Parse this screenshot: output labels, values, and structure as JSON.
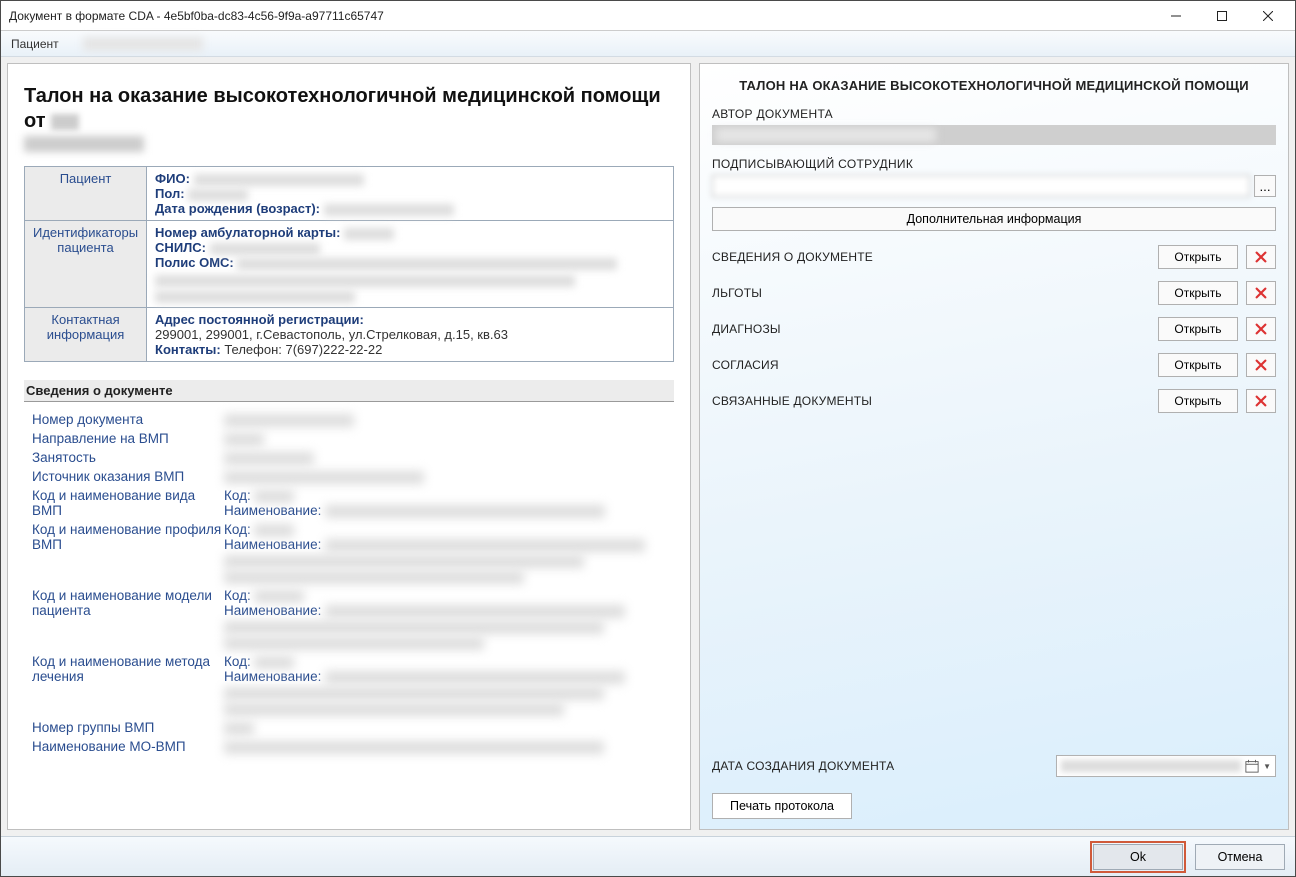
{
  "window": {
    "title": "Документ в формате CDA - 4e5bf0ba-dc83-4c56-9f9a-a97711c65747"
  },
  "header": {
    "patient_label": "Пациент"
  },
  "left": {
    "title_prefix": "Талон на оказание высокотехнологичной медицинской помощи от",
    "patient_block": {
      "label": "Пациент",
      "fio": "ФИО:",
      "sex": "Пол:",
      "dob": "Дата рождения (возраст):"
    },
    "ids_block": {
      "label": "Идентификаторы пациента",
      "card": "Номер амбулаторной карты:",
      "snils": "СНИЛС:",
      "oms": "Полис ОМС:"
    },
    "contact_block": {
      "label": "Контактная информация",
      "addr_label": "Адрес постоянной регистрации:",
      "addr_value": "299001, 299001, г.Севастополь, ул.Стрелковая, д.15, кв.63",
      "contacts_label": "Контакты:",
      "contacts_value": "Телефон: 7(697)222-22-22"
    },
    "section_title": "Сведения о документе",
    "rows": {
      "doc_number": "Номер документа",
      "referral": "Направление на ВМП",
      "employment": "Занятость",
      "source": "Источник оказания ВМП",
      "kind": "Код и наименование вида ВМП",
      "profile": "Код и наименование профиля ВМП",
      "model": "Код и наименование модели пациента",
      "method": "Код и наименование метода лечения",
      "group": "Номер группы ВМП",
      "mo": "Наименование МО-ВМП",
      "code_lbl": "Код:",
      "name_lbl": "Наименование:"
    }
  },
  "right": {
    "title": "ТАЛОН НА ОКАЗАНИЕ ВЫСОКОТЕХНОЛОГИЧНОЙ МЕДИЦИНСКОЙ ПОМОЩИ",
    "author_label": "АВТОР ДОКУМЕНТА",
    "signer_label": "ПОДПИСЫВАЮЩИЙ СОТРУДНИК",
    "picker": "...",
    "add_info": "Дополнительная информация",
    "sections": [
      {
        "label": "СВЕДЕНИЯ О ДОКУМЕНТЕ",
        "open": "Открыть"
      },
      {
        "label": "ЛЬГОТЫ",
        "open": "Открыть"
      },
      {
        "label": "ДИАГНОЗЫ",
        "open": "Открыть"
      },
      {
        "label": "СОГЛАСИЯ",
        "open": "Открыть"
      },
      {
        "label": "СВЯЗАННЫЕ ДОКУМЕНТЫ",
        "open": "Открыть"
      }
    ],
    "date_label": "ДАТА СОЗДАНИЯ ДОКУМЕНТА",
    "print": "Печать протокола"
  },
  "footer": {
    "ok": "Ok",
    "cancel": "Отмена"
  }
}
